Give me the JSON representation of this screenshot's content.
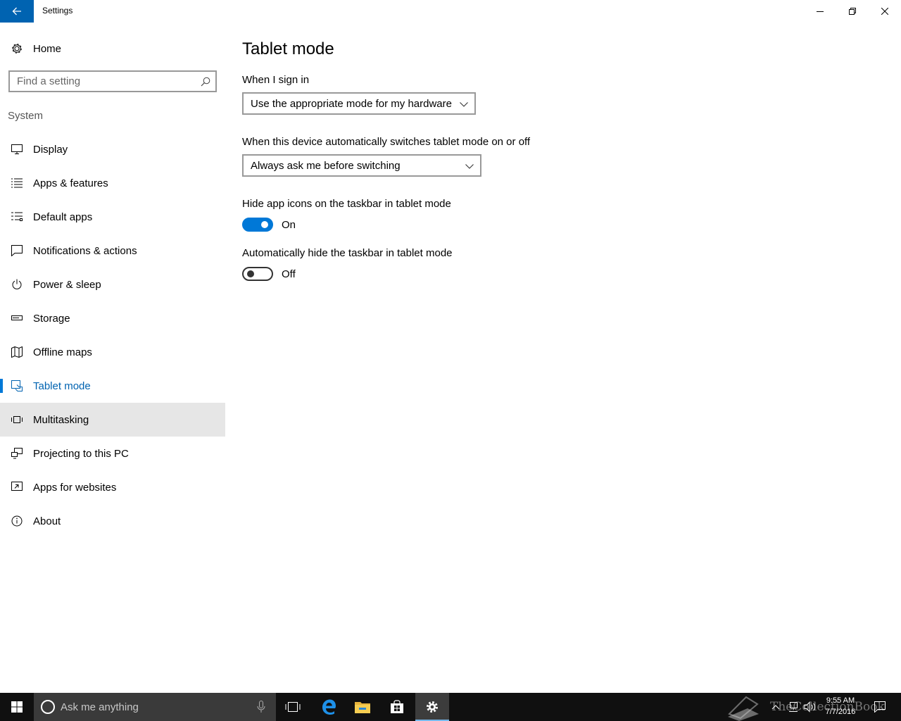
{
  "window": {
    "title": "Settings"
  },
  "sidebar": {
    "home_label": "Home",
    "search_placeholder": "Find a setting",
    "section": "System",
    "items": [
      {
        "label": "Display",
        "icon": "monitor-icon"
      },
      {
        "label": "Apps & features",
        "icon": "list-icon"
      },
      {
        "label": "Default apps",
        "icon": "default-apps-icon"
      },
      {
        "label": "Notifications & actions",
        "icon": "notification-icon"
      },
      {
        "label": "Power & sleep",
        "icon": "power-icon"
      },
      {
        "label": "Storage",
        "icon": "storage-icon"
      },
      {
        "label": "Offline maps",
        "icon": "map-icon"
      },
      {
        "label": "Tablet mode",
        "icon": "tablet-mode-icon"
      },
      {
        "label": "Multitasking",
        "icon": "multitasking-icon"
      },
      {
        "label": "Projecting to this PC",
        "icon": "projecting-icon"
      },
      {
        "label": "Apps for websites",
        "icon": "apps-websites-icon"
      },
      {
        "label": "About",
        "icon": "info-icon"
      }
    ],
    "active_item": "Tablet mode",
    "hovered_item": "Multitasking"
  },
  "main": {
    "title": "Tablet mode",
    "signin_label": "When I sign in",
    "signin_value": "Use the appropriate mode for my hardware",
    "switch_label": "When this device automatically switches tablet mode on or off",
    "switch_value": "Always ask me before switching",
    "hide_icons_label": "Hide app icons on the taskbar in tablet mode",
    "hide_icons_state": "On",
    "hide_taskbar_label": "Automatically hide the taskbar in tablet mode",
    "hide_taskbar_state": "Off"
  },
  "taskbar": {
    "search_placeholder": "Ask me anything",
    "time": "9:55 AM",
    "date": "7/7/2016",
    "watermark": "TheCollectionBook"
  },
  "colors": {
    "accent": "#0078d7",
    "back_button": "#0063b1",
    "taskbar": "#101010",
    "hover": "#e6e6e6"
  }
}
